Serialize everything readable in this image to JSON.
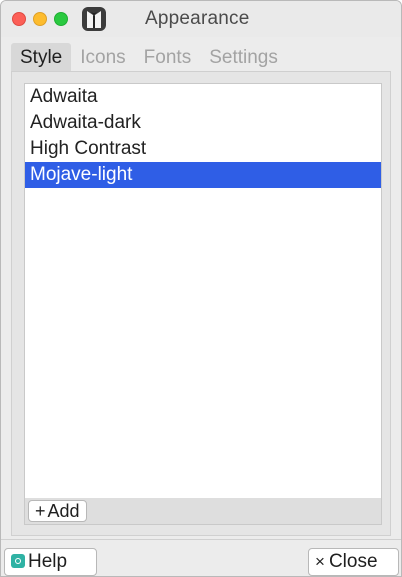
{
  "window": {
    "title": "Appearance"
  },
  "tabs": [
    {
      "label": "Style",
      "active": true
    },
    {
      "label": "Icons",
      "active": false
    },
    {
      "label": "Fonts",
      "active": false
    },
    {
      "label": "Settings",
      "active": false
    }
  ],
  "style_list": {
    "items": [
      {
        "label": "Adwaita",
        "selected": false
      },
      {
        "label": "Adwaita-dark",
        "selected": false
      },
      {
        "label": "High Contrast",
        "selected": false
      },
      {
        "label": "Mojave-light",
        "selected": true
      }
    ],
    "add_label": "Add",
    "add_symbol": "+"
  },
  "footer": {
    "help_label": "Help",
    "help_icon": "help-icon",
    "close_label": "Close",
    "close_symbol": "×"
  },
  "colors": {
    "selection": "#2f5ee6",
    "help_icon": "#2fb2a4"
  }
}
